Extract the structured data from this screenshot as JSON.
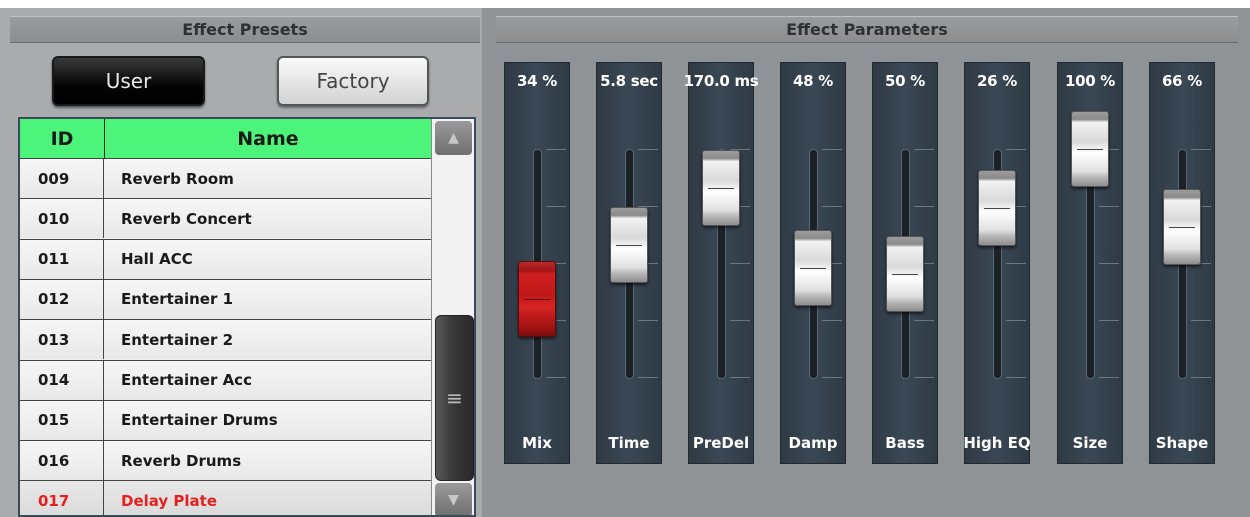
{
  "headers": {
    "presets_title": "Effect Presets",
    "params_title": "Effect Parameters"
  },
  "bank_buttons": {
    "user_label": "User",
    "factory_label": "Factory",
    "active": "User"
  },
  "preset_table": {
    "col_id": "ID",
    "col_name": "Name",
    "rows": [
      {
        "id": "009",
        "name": "Reverb Room"
      },
      {
        "id": "010",
        "name": "Reverb Concert"
      },
      {
        "id": "011",
        "name": "Hall ACC"
      },
      {
        "id": "012",
        "name": "Entertainer 1"
      },
      {
        "id": "013",
        "name": "Entertainer 2"
      },
      {
        "id": "014",
        "name": "Entertainer Acc"
      },
      {
        "id": "015",
        "name": "Entertainer Drums"
      },
      {
        "id": "016",
        "name": "Reverb Drums"
      },
      {
        "id": "017",
        "name": "Delay Plate"
      }
    ],
    "selected_id": "017",
    "scroll_up_icon": "triangle-up-icon",
    "scroll_down_icon": "triangle-down-icon",
    "scroll_thumb_icon": "grip-lines-icon"
  },
  "faders": [
    {
      "name": "Mix",
      "value": "34 %",
      "level": 0.34,
      "color": "#c81c1c"
    },
    {
      "name": "Time",
      "value": "5.8 sec",
      "level": 0.58,
      "color": "#e0e0e0"
    },
    {
      "name": "PreDel",
      "value": "170.0 ms",
      "level": 0.83,
      "color": "#e0e0e0"
    },
    {
      "name": "Damp",
      "value": "48 %",
      "level": 0.48,
      "color": "#e0e0e0"
    },
    {
      "name": "Bass",
      "value": "50 %",
      "level": 0.45,
      "color": "#e0e0e0"
    },
    {
      "name": "High EQ",
      "value": "26 %",
      "level": 0.74,
      "color": "#e0e0e0"
    },
    {
      "name": "Size",
      "value": "100 %",
      "level": 1.0,
      "color": "#e0e0e0"
    },
    {
      "name": "Shape",
      "value": "66 %",
      "level": 0.66,
      "color": "#e0e0e0"
    }
  ],
  "colors": {
    "header_green": "#4cf47a",
    "selected_text": "#e62020",
    "fader_strip": "#34414d"
  }
}
